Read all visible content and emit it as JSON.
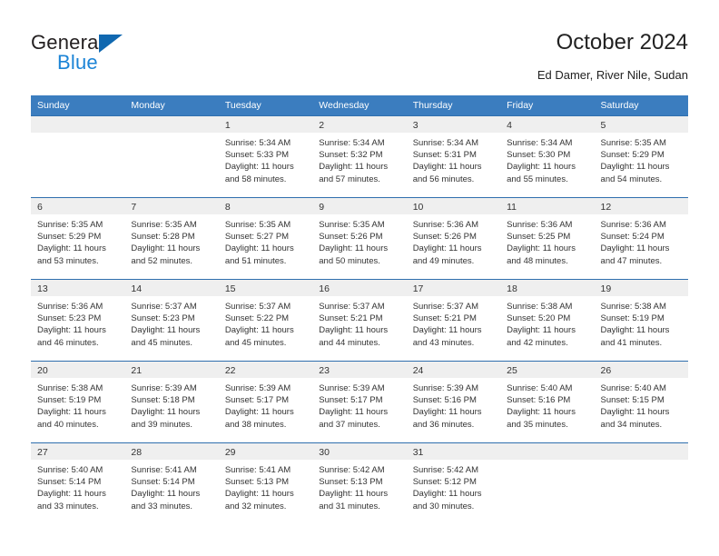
{
  "brand": {
    "name_top": "General",
    "name_bottom": "Blue",
    "triangle_color": "#1068b0",
    "blue_color": "#1c84d6"
  },
  "header": {
    "title": "October 2024",
    "subtitle": "Ed Damer, River Nile, Sudan"
  },
  "theme": {
    "header_bg": "#3b7dbf",
    "row_divider": "#2f6fae",
    "day_band_bg": "#efefef",
    "text": "#333333"
  },
  "weekdays": [
    "Sunday",
    "Monday",
    "Tuesday",
    "Wednesday",
    "Thursday",
    "Friday",
    "Saturday"
  ],
  "weeks": [
    [
      {
        "day": "",
        "blank": true,
        "sunrise": "",
        "sunset": "",
        "daylight": ""
      },
      {
        "day": "",
        "blank": true,
        "sunrise": "",
        "sunset": "",
        "daylight": ""
      },
      {
        "day": "1",
        "sunrise": "Sunrise: 5:34 AM",
        "sunset": "Sunset: 5:33 PM",
        "daylight": "Daylight: 11 hours and 58 minutes."
      },
      {
        "day": "2",
        "sunrise": "Sunrise: 5:34 AM",
        "sunset": "Sunset: 5:32 PM",
        "daylight": "Daylight: 11 hours and 57 minutes."
      },
      {
        "day": "3",
        "sunrise": "Sunrise: 5:34 AM",
        "sunset": "Sunset: 5:31 PM",
        "daylight": "Daylight: 11 hours and 56 minutes."
      },
      {
        "day": "4",
        "sunrise": "Sunrise: 5:34 AM",
        "sunset": "Sunset: 5:30 PM",
        "daylight": "Daylight: 11 hours and 55 minutes."
      },
      {
        "day": "5",
        "sunrise": "Sunrise: 5:35 AM",
        "sunset": "Sunset: 5:29 PM",
        "daylight": "Daylight: 11 hours and 54 minutes."
      }
    ],
    [
      {
        "day": "6",
        "sunrise": "Sunrise: 5:35 AM",
        "sunset": "Sunset: 5:29 PM",
        "daylight": "Daylight: 11 hours and 53 minutes."
      },
      {
        "day": "7",
        "sunrise": "Sunrise: 5:35 AM",
        "sunset": "Sunset: 5:28 PM",
        "daylight": "Daylight: 11 hours and 52 minutes."
      },
      {
        "day": "8",
        "sunrise": "Sunrise: 5:35 AM",
        "sunset": "Sunset: 5:27 PM",
        "daylight": "Daylight: 11 hours and 51 minutes."
      },
      {
        "day": "9",
        "sunrise": "Sunrise: 5:35 AM",
        "sunset": "Sunset: 5:26 PM",
        "daylight": "Daylight: 11 hours and 50 minutes."
      },
      {
        "day": "10",
        "sunrise": "Sunrise: 5:36 AM",
        "sunset": "Sunset: 5:26 PM",
        "daylight": "Daylight: 11 hours and 49 minutes."
      },
      {
        "day": "11",
        "sunrise": "Sunrise: 5:36 AM",
        "sunset": "Sunset: 5:25 PM",
        "daylight": "Daylight: 11 hours and 48 minutes."
      },
      {
        "day": "12",
        "sunrise": "Sunrise: 5:36 AM",
        "sunset": "Sunset: 5:24 PM",
        "daylight": "Daylight: 11 hours and 47 minutes."
      }
    ],
    [
      {
        "day": "13",
        "sunrise": "Sunrise: 5:36 AM",
        "sunset": "Sunset: 5:23 PM",
        "daylight": "Daylight: 11 hours and 46 minutes."
      },
      {
        "day": "14",
        "sunrise": "Sunrise: 5:37 AM",
        "sunset": "Sunset: 5:23 PM",
        "daylight": "Daylight: 11 hours and 45 minutes."
      },
      {
        "day": "15",
        "sunrise": "Sunrise: 5:37 AM",
        "sunset": "Sunset: 5:22 PM",
        "daylight": "Daylight: 11 hours and 45 minutes."
      },
      {
        "day": "16",
        "sunrise": "Sunrise: 5:37 AM",
        "sunset": "Sunset: 5:21 PM",
        "daylight": "Daylight: 11 hours and 44 minutes."
      },
      {
        "day": "17",
        "sunrise": "Sunrise: 5:37 AM",
        "sunset": "Sunset: 5:21 PM",
        "daylight": "Daylight: 11 hours and 43 minutes."
      },
      {
        "day": "18",
        "sunrise": "Sunrise: 5:38 AM",
        "sunset": "Sunset: 5:20 PM",
        "daylight": "Daylight: 11 hours and 42 minutes."
      },
      {
        "day": "19",
        "sunrise": "Sunrise: 5:38 AM",
        "sunset": "Sunset: 5:19 PM",
        "daylight": "Daylight: 11 hours and 41 minutes."
      }
    ],
    [
      {
        "day": "20",
        "sunrise": "Sunrise: 5:38 AM",
        "sunset": "Sunset: 5:19 PM",
        "daylight": "Daylight: 11 hours and 40 minutes."
      },
      {
        "day": "21",
        "sunrise": "Sunrise: 5:39 AM",
        "sunset": "Sunset: 5:18 PM",
        "daylight": "Daylight: 11 hours and 39 minutes."
      },
      {
        "day": "22",
        "sunrise": "Sunrise: 5:39 AM",
        "sunset": "Sunset: 5:17 PM",
        "daylight": "Daylight: 11 hours and 38 minutes."
      },
      {
        "day": "23",
        "sunrise": "Sunrise: 5:39 AM",
        "sunset": "Sunset: 5:17 PM",
        "daylight": "Daylight: 11 hours and 37 minutes."
      },
      {
        "day": "24",
        "sunrise": "Sunrise: 5:39 AM",
        "sunset": "Sunset: 5:16 PM",
        "daylight": "Daylight: 11 hours and 36 minutes."
      },
      {
        "day": "25",
        "sunrise": "Sunrise: 5:40 AM",
        "sunset": "Sunset: 5:16 PM",
        "daylight": "Daylight: 11 hours and 35 minutes."
      },
      {
        "day": "26",
        "sunrise": "Sunrise: 5:40 AM",
        "sunset": "Sunset: 5:15 PM",
        "daylight": "Daylight: 11 hours and 34 minutes."
      }
    ],
    [
      {
        "day": "27",
        "sunrise": "Sunrise: 5:40 AM",
        "sunset": "Sunset: 5:14 PM",
        "daylight": "Daylight: 11 hours and 33 minutes."
      },
      {
        "day": "28",
        "sunrise": "Sunrise: 5:41 AM",
        "sunset": "Sunset: 5:14 PM",
        "daylight": "Daylight: 11 hours and 33 minutes."
      },
      {
        "day": "29",
        "sunrise": "Sunrise: 5:41 AM",
        "sunset": "Sunset: 5:13 PM",
        "daylight": "Daylight: 11 hours and 32 minutes."
      },
      {
        "day": "30",
        "sunrise": "Sunrise: 5:42 AM",
        "sunset": "Sunset: 5:13 PM",
        "daylight": "Daylight: 11 hours and 31 minutes."
      },
      {
        "day": "31",
        "sunrise": "Sunrise: 5:42 AM",
        "sunset": "Sunset: 5:12 PM",
        "daylight": "Daylight: 11 hours and 30 minutes."
      },
      {
        "day": "",
        "blank": true,
        "sunrise": "",
        "sunset": "",
        "daylight": ""
      },
      {
        "day": "",
        "blank": true,
        "sunrise": "",
        "sunset": "",
        "daylight": ""
      }
    ]
  ]
}
